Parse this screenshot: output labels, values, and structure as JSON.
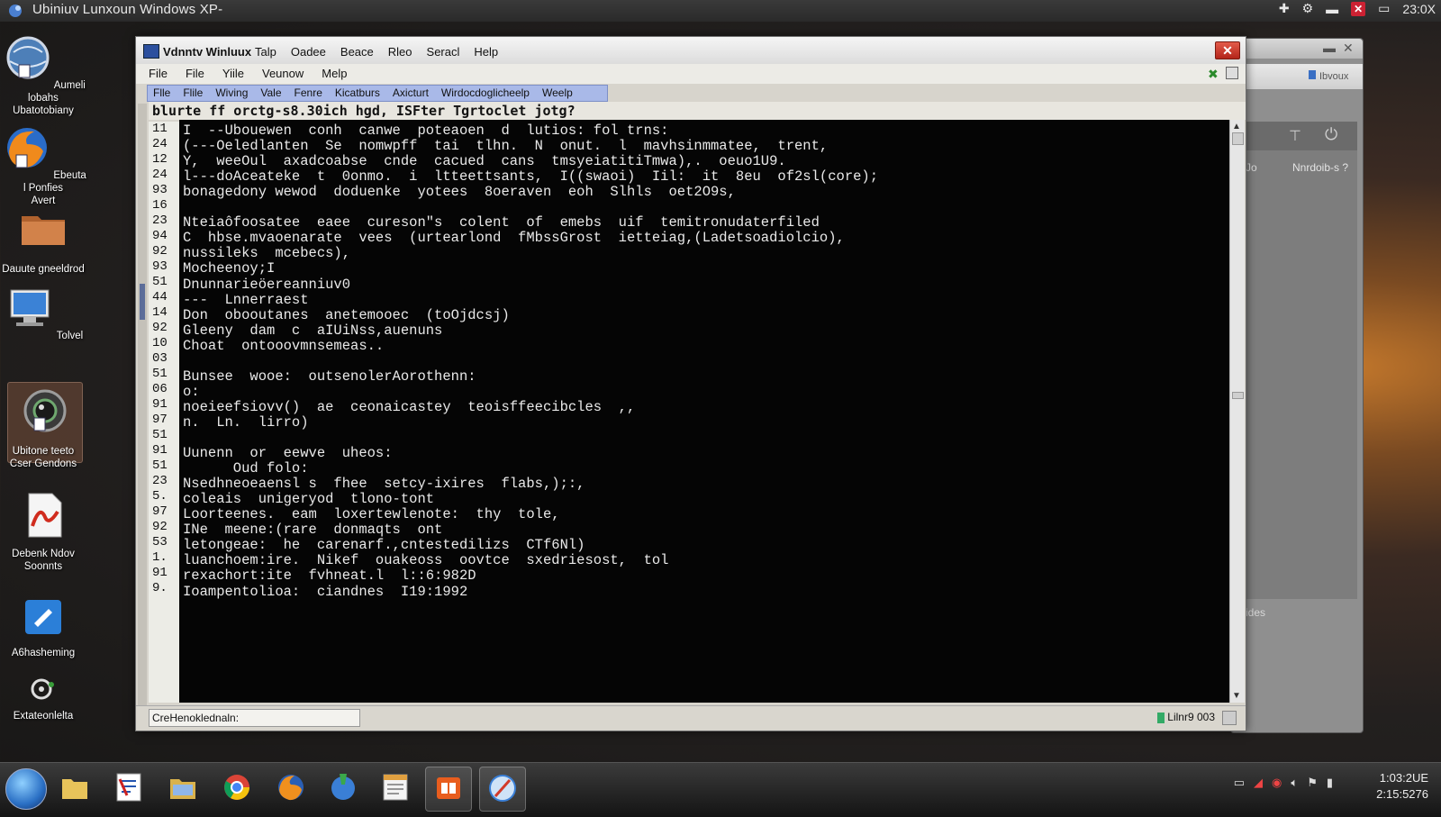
{
  "topbar": {
    "title": "Ubiniuv Lunxoun  Windows XP-",
    "clock": "23:0X"
  },
  "desktop_icons": [
    {
      "label": "Aumeli lobahs\nUbatotobiany",
      "icon": "globe-document-icon"
    },
    {
      "label": "Ebeuta l Ponfies\nAvert",
      "icon": "firefox-icon"
    },
    {
      "label": "Dauute gneeldrod",
      "icon": "folder-icon"
    },
    {
      "label": "Tolvel",
      "icon": "computer-icon"
    },
    {
      "label": "Ubitone teeto\nCser Gendons",
      "icon": "webcam-icon"
    },
    {
      "label": "Debenk Ndov\nSoonnts",
      "icon": "pdf-icon"
    },
    {
      "label": "A6hasheming",
      "icon": "pen-tool-icon"
    },
    {
      "label": "Extateonlelta",
      "icon": "settings-icon"
    }
  ],
  "back_window": {
    "button_label": "Ibvoux",
    "pane_text": "Nnrdoib-s ?",
    "side_label_1": "Jo",
    "side_label_2": "ides"
  },
  "window": {
    "app_title": "Vdnntv  Winluux",
    "title_menus": [
      "Talp",
      "Oadee",
      "Beace",
      "Rleo",
      "Seracl",
      "Help"
    ],
    "menubar": [
      "File",
      "File",
      "Yiile",
      "Veunow",
      "Melp"
    ],
    "menubar2": [
      "Flle",
      "Flile",
      "Wiving",
      "Vale",
      "Fenre",
      "Kicatburs",
      "Axicturt",
      "Wirdocdoglicheelp",
      "Weelp"
    ],
    "command_line": "blurte  ff  orctg-s8.30ich  hgd, ISFter  Tgrtoclet  jotg?",
    "line_numbers": [
      "11",
      "24",
      "12",
      "24",
      "93",
      "16",
      "23",
      "94",
      "92",
      "93",
      "51",
      "44",
      "14",
      "92",
      "10",
      "03",
      "51",
      "06",
      "91",
      "97",
      "51",
      "91",
      "51",
      "23",
      "5.",
      "97",
      "92",
      "53",
      "1.",
      "91",
      "9."
    ],
    "lines": [
      "I  --Ubouewen  conh  canwe  poteaoen  d  lutios: fol trns:",
      "(---Oeledlanten  Se  nomwpff  tai  tlhn.  N  onut.  l  mavhsinmmatee,  trent,",
      "Y,  weeOul  axadcoabse  cnde  cacued  cans  tmsyeiatitiTmwa),.  oeuo1U9.",
      "l---doAceateke  t  0onmo.  i  ltteettsants,  I((swaoi)  Iil:  it  8eu  of2sl(core);",
      "bonagedony wewod  doduenke  yotees  8oeraven  eoh  Slhls  oet2O9s,",
      "",
      "Nteiaôfoosatee  eaee  cureson\"s  colent  of  emebs  uif  temitronudaterfiled",
      "C  hbse.mvaoenarate  vees  (urtearlond  fMbssGrost  ietteiag,(Ladetsoadiolcio),",
      "nussileks  mcebecs),",
      "Mocheenoy;I",
      "Dnunnarieöereanniuv0",
      "---  Lnnerraest",
      "Don  obooutanes  anetemooec  (toOjdcsj)",
      "Gleeny  dam  c  aIUiNss,auenuns",
      "Choat  ontooovmnsemeas..",
      "",
      "Bunsee  wooe:  outsenolerAorothenn:",
      "o:",
      "noeieefsiovv()  ae  ceonaicastey  teoisffeecibcles  ,,",
      "n.  Ln.  lirro)",
      "",
      "Uunenn  or  eewve  uheos:",
      "      Oud folo:",
      "Nsedhneoeaensl s  fhee  setcy-ixires  flabs,);:,",
      "coleais  unigeryod  tlono-tont",
      "Loorteenes.  eam  loxertewlenote:  thy  tole,",
      "INe  meene:(rare  donmaqts  ont",
      "letongeae:  he  carenarf.,cntestedilizs  CTf6Nl)",
      "luanchoem:ire.  Nikef  ouakeoss  oovtce  sxedriesost,  tol",
      "rexachort:ite  fvhneat.l  l::6:982D",
      "Ioampentolioa:  ciandnes  I19:1992"
    ],
    "status_field": "CreHenoklednaln:",
    "status_right": "Lilnr9 003"
  },
  "taskbar": {
    "apps": [
      "folder",
      "text-editor",
      "file-manager",
      "chrome",
      "firefox",
      "paint",
      "notes",
      "presentation",
      "browser"
    ],
    "clock_time": "1:03:2UE",
    "clock_date": "2:15:5276"
  }
}
